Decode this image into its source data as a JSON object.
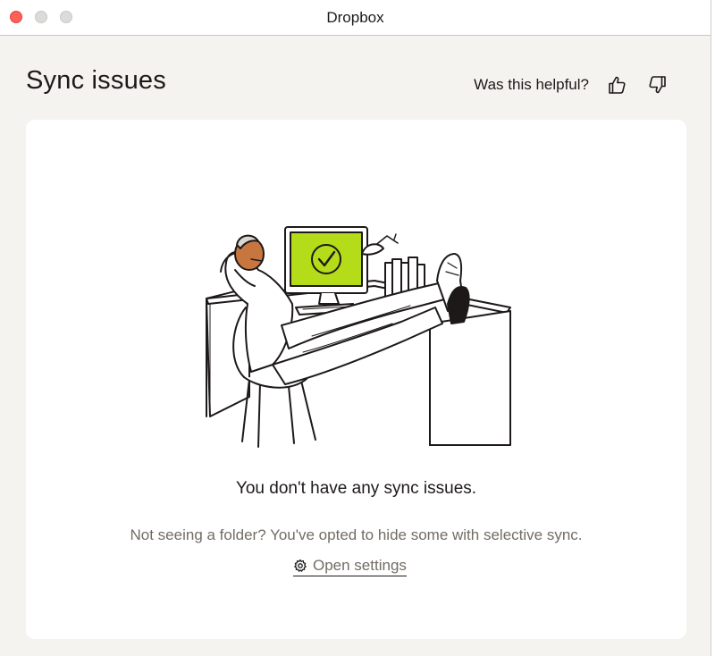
{
  "window": {
    "title": "Dropbox"
  },
  "header": {
    "title": "Sync issues",
    "feedback_label": "Was this helpful?",
    "thumbs_up_icon": "thumbs-up-icon",
    "thumbs_down_icon": "thumbs-down-icon"
  },
  "empty_state": {
    "heading": "You don't have any sync issues.",
    "subtext": "Not seeing a folder? You've opted to hide some with selective sync.",
    "link_label": "Open settings",
    "link_icon": "gear-icon",
    "illustration": "person-relaxing-at-desk-illustration"
  },
  "colors": {
    "background": "#f5f3ef",
    "card": "#ffffff",
    "text_primary": "#1e1919",
    "text_secondary": "#736c64",
    "accent_green": "#b4dc19",
    "skin": "#c8763f",
    "close_button": "#fe5f57"
  }
}
